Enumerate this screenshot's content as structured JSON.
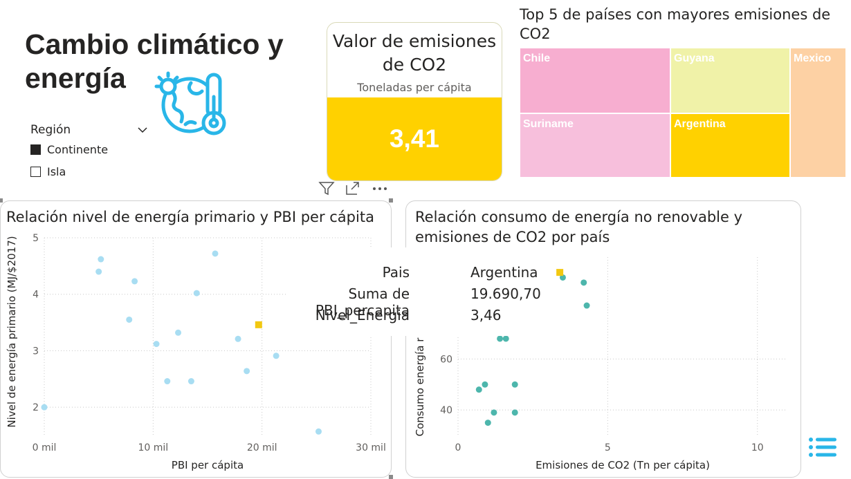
{
  "page": {
    "title": "Cambio climático y energía"
  },
  "slicer": {
    "label": "Región",
    "options": [
      {
        "label": "Continente",
        "checked": true
      },
      {
        "label": "Isla",
        "checked": false
      }
    ]
  },
  "kpi": {
    "title": "Valor de emisiones de CO2",
    "subtitle": "Toneladas per cápita",
    "value": "3,41",
    "color": "#FFD100"
  },
  "colors": {
    "highlight": "#F2C811",
    "scatter_light": "#A8DDF2",
    "scatter_teal": "#4DB6AC",
    "icon_blue": "#29B6E8"
  },
  "chart_data": [
    {
      "type": "treemap",
      "title": "Top 5 de países con mayores emisiones de CO2",
      "items": [
        {
          "label": "Chile",
          "value": 4.6,
          "color": "#F7AED0"
        },
        {
          "label": "Guyana",
          "value": 3.4,
          "color": "#F0F2A8"
        },
        {
          "label": "Mexico",
          "value": 3.5,
          "color": "#FDD1A4"
        },
        {
          "label": "Suriname",
          "value": 3.4,
          "color": "#F7BFDC"
        },
        {
          "label": "Argentina",
          "value": 3.4,
          "color": "#FFD100"
        }
      ]
    },
    {
      "type": "scatter",
      "title": "Relación nivel de energía primario y PBI per cápita",
      "xlabel": "PBI per cápita",
      "ylabel": "Nivel de energía primario (MJ/$2017)",
      "xlim": [
        0,
        30000
      ],
      "ylim": [
        1.5,
        5
      ],
      "xticks": [
        0,
        10000,
        20000,
        30000
      ],
      "xtick_labels": [
        "0 mil",
        "10 mil",
        "20 mil",
        "30 mil"
      ],
      "yticks": [
        2,
        3,
        4,
        5
      ],
      "ytick_labels": [
        "2",
        "3",
        "4",
        "5"
      ],
      "points": [
        {
          "x": 5200,
          "y": 4.62
        },
        {
          "x": 5000,
          "y": 4.4
        },
        {
          "x": 8300,
          "y": 4.23
        },
        {
          "x": 7800,
          "y": 3.55
        },
        {
          "x": 15700,
          "y": 4.72
        },
        {
          "x": 14000,
          "y": 4.02
        },
        {
          "x": 10300,
          "y": 3.12
        },
        {
          "x": 12300,
          "y": 3.32
        },
        {
          "x": 17800,
          "y": 3.21
        },
        {
          "x": 21300,
          "y": 2.91
        },
        {
          "x": 11300,
          "y": 2.46
        },
        {
          "x": 13500,
          "y": 2.46
        },
        {
          "x": 18600,
          "y": 2.64
        },
        {
          "x": 0,
          "y": 2.0
        },
        {
          "x": 25200,
          "y": 1.57
        }
      ],
      "highlight": {
        "label": "Argentina",
        "x": 19690.7,
        "y": 3.46
      }
    },
    {
      "type": "scatter",
      "title": "Relación consumo de energía no renovable y emisiones de CO2 por país",
      "xlabel": "Emisiones de CO2 (Tn per cápita)",
      "ylabel": "Consumo energía r",
      "xlim": [
        0,
        11
      ],
      "ylim": [
        30,
        100
      ],
      "xticks": [
        0,
        5,
        10
      ],
      "xtick_labels": [
        "0",
        "5",
        "10"
      ],
      "yticks": [
        40,
        60
      ],
      "ytick_labels": [
        "40",
        "60"
      ],
      "points": [
        {
          "x": 3.5,
          "y": 92
        },
        {
          "x": 4.2,
          "y": 90
        },
        {
          "x": 4.3,
          "y": 81
        },
        {
          "x": 1.4,
          "y": 68
        },
        {
          "x": 1.6,
          "y": 68
        },
        {
          "x": 0.9,
          "y": 50
        },
        {
          "x": 0.7,
          "y": 48
        },
        {
          "x": 1.9,
          "y": 50
        },
        {
          "x": 1.2,
          "y": 39
        },
        {
          "x": 1.9,
          "y": 39
        },
        {
          "x": 1.0,
          "y": 35
        }
      ],
      "highlight": {
        "label": "Argentina",
        "x": 3.4,
        "y": 94
      }
    }
  ],
  "tooltip": {
    "rows": [
      {
        "key": "Pais",
        "value": "Argentina"
      },
      {
        "key": "Suma de PBI_percapita",
        "value": "19.690,70"
      },
      {
        "key": "Nivel_Energia",
        "value": "3,46"
      }
    ]
  },
  "icons": {
    "logo": "climate-earth-thermometer-icon",
    "filter": "filter-icon",
    "focus": "focus-mode-icon",
    "more": "more-options-icon",
    "list": "list-icon",
    "dropdown": "chevron-down-icon"
  }
}
